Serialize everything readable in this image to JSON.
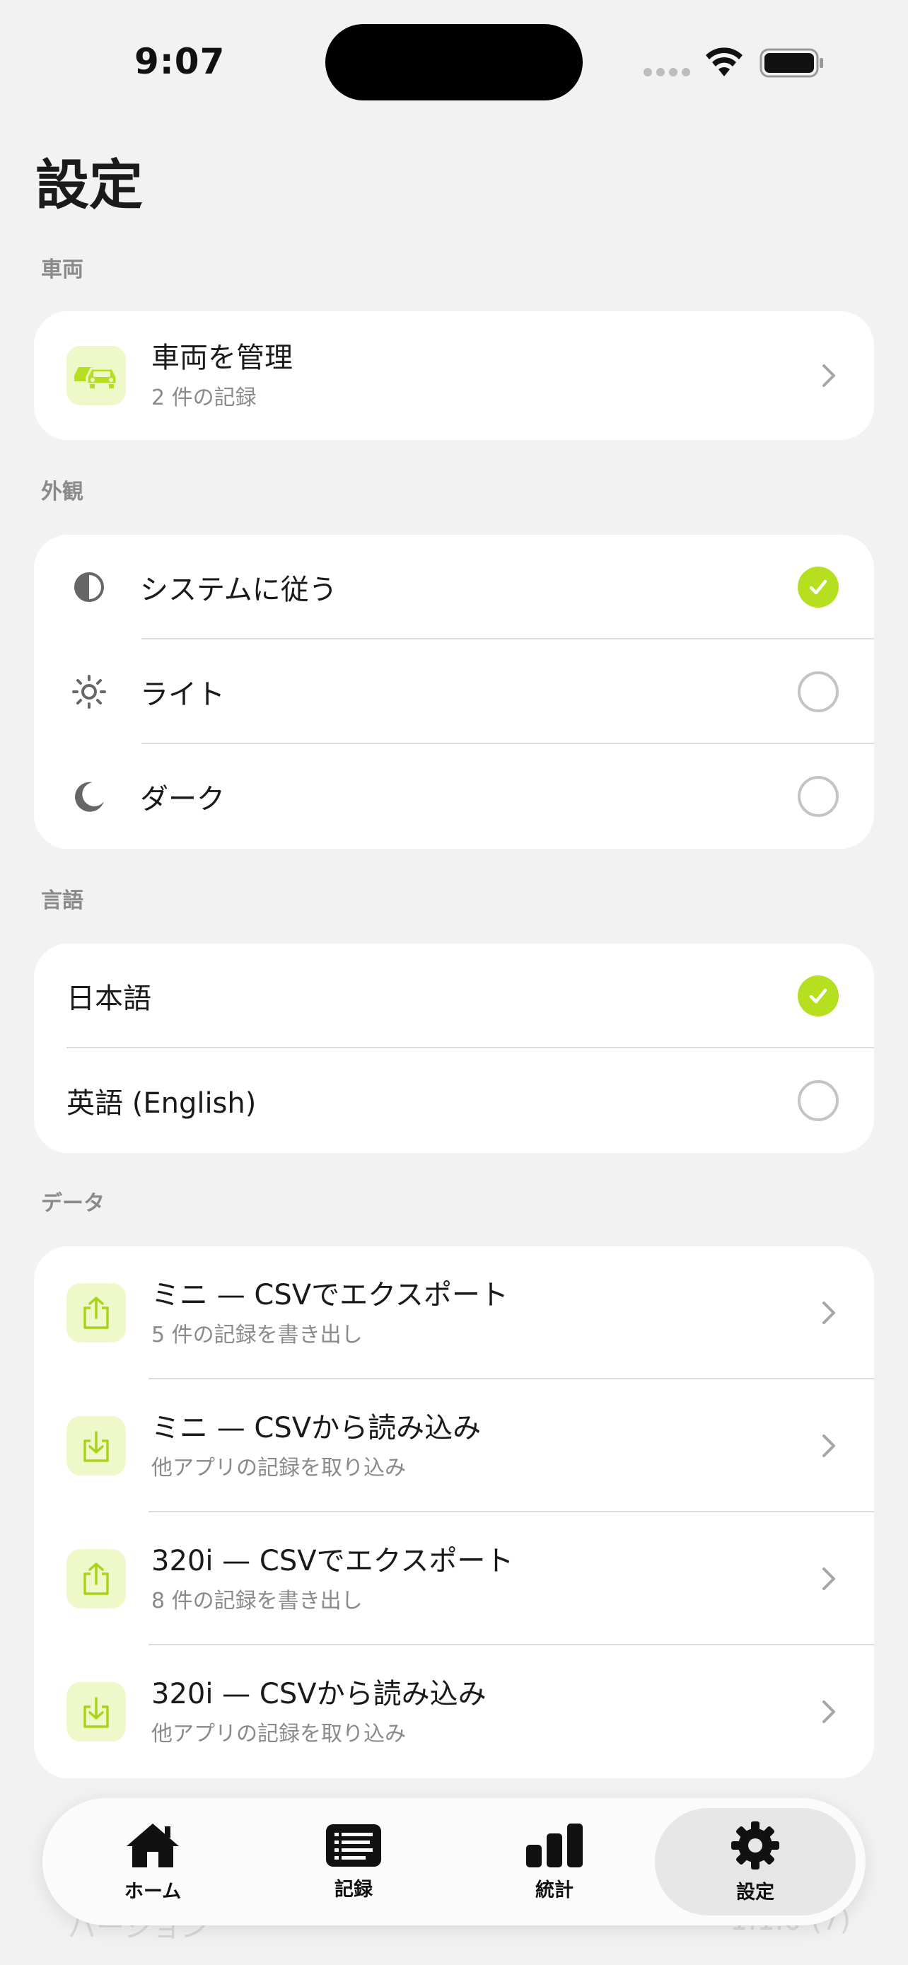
{
  "status_bar": {
    "time": "9:07"
  },
  "page": {
    "title": "設定"
  },
  "sections": {
    "vehicles": {
      "label": "車両",
      "manage": {
        "title": "車両を管理",
        "subtitle": "2 件の記録",
        "icon": "cars-icon"
      }
    },
    "appearance": {
      "label": "外観",
      "options": [
        {
          "label": "システムに従う",
          "icon": "half-circle-icon",
          "selected": true
        },
        {
          "label": "ライト",
          "icon": "sun-icon",
          "selected": false
        },
        {
          "label": "ダーク",
          "icon": "moon-icon",
          "selected": false
        }
      ]
    },
    "language": {
      "label": "言語",
      "options": [
        {
          "label": "日本語",
          "selected": true
        },
        {
          "label": "英語 (English)",
          "selected": false
        }
      ]
    },
    "data": {
      "label": "データ",
      "items": [
        {
          "title": "ミニ — CSVでエクスポート",
          "subtitle": "5 件の記録を書き出し",
          "icon": "export-icon"
        },
        {
          "title": "ミニ — CSVから読み込み",
          "subtitle": "他アプリの記録を取り込み",
          "icon": "import-icon"
        },
        {
          "title": "320i — CSVでエクスポート",
          "subtitle": "8 件の記録を書き出し",
          "icon": "export-icon"
        },
        {
          "title": "320i — CSVから読み込み",
          "subtitle": "他アプリの記録を取り込み",
          "icon": "import-icon"
        }
      ]
    },
    "app_info": {
      "version_label": "バージョン",
      "version_value": "1.1.0 (7)"
    }
  },
  "tabbar": {
    "tabs": [
      {
        "label": "ホーム",
        "icon": "house-icon",
        "active": false
      },
      {
        "label": "記録",
        "icon": "list-icon",
        "active": false
      },
      {
        "label": "統計",
        "icon": "bar-chart-icon",
        "active": false
      },
      {
        "label": "設定",
        "icon": "gear-icon",
        "active": true
      }
    ]
  },
  "colors": {
    "accent": "#b5df1f",
    "accent_tile": "#eef8c8",
    "background": "#f2f2f2"
  }
}
